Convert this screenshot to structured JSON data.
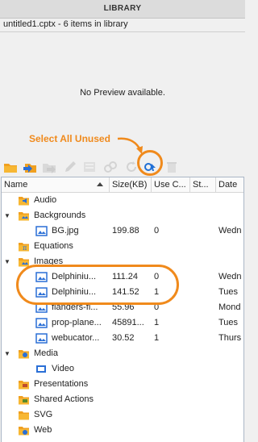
{
  "panel": {
    "title": "LIBRARY",
    "subtitle": "untitled1.cptx - 6 items in library"
  },
  "preview": {
    "text": "No Preview available."
  },
  "annotation": {
    "label": "Select All Unused",
    "color": "#f08a1c"
  },
  "toolbar": {
    "items": [
      {
        "name": "open-folder-icon",
        "enabled": true
      },
      {
        "name": "import-icon",
        "enabled": true
      },
      {
        "name": "export-icon",
        "enabled": false
      },
      {
        "name": "edit-icon",
        "enabled": false
      },
      {
        "name": "properties-icon",
        "enabled": false
      },
      {
        "name": "usage-icon",
        "enabled": false
      },
      {
        "name": "update-icon",
        "enabled": false
      },
      {
        "name": "select-all-unused-icon",
        "enabled": true
      },
      {
        "name": "delete-icon",
        "enabled": false
      }
    ]
  },
  "columns": [
    "Name",
    "Size(KB)",
    "Use C...",
    "St...",
    "Date"
  ],
  "rows": [
    {
      "type": "folder",
      "name": "Audio",
      "icon": "audio-folder-icon",
      "expandable": false
    },
    {
      "type": "folder",
      "name": "Backgrounds",
      "icon": "backgrounds-folder-icon",
      "expandable": true
    },
    {
      "type": "item",
      "name": "BG.jpg",
      "size": "199.88",
      "use": "0",
      "status": "",
      "date": "Wedn",
      "icon": "image-icon"
    },
    {
      "type": "folder",
      "name": "Equations",
      "icon": "equations-folder-icon",
      "expandable": false
    },
    {
      "type": "folder",
      "name": "Images",
      "icon": "images-folder-icon",
      "expandable": true
    },
    {
      "type": "item",
      "name": "Delphiniu...",
      "size": "111.24",
      "use": "0",
      "status": "",
      "date": "Wedn",
      "icon": "image-icon"
    },
    {
      "type": "item",
      "name": "Delphiniu...",
      "size": "141.52",
      "use": "1",
      "status": "",
      "date": "Tues",
      "icon": "image-icon"
    },
    {
      "type": "item",
      "name": "flanders-fi...",
      "size": "55.96",
      "use": "0",
      "status": "",
      "date": "Mond",
      "icon": "image-icon"
    },
    {
      "type": "item",
      "name": "prop-plane...",
      "size": "45891...",
      "use": "1",
      "status": "",
      "date": "Tues",
      "icon": "image-icon"
    },
    {
      "type": "item",
      "name": "webucator...",
      "size": "30.52",
      "use": "1",
      "status": "",
      "date": "Thurs",
      "icon": "image-icon"
    },
    {
      "type": "folder",
      "name": "Media",
      "icon": "media-folder-icon",
      "expandable": true
    },
    {
      "type": "item",
      "name": "Video",
      "size": "",
      "use": "",
      "status": "",
      "date": "",
      "icon": "video-folder-icon"
    },
    {
      "type": "folder",
      "name": "Presentations",
      "icon": "presentations-folder-icon",
      "expandable": false
    },
    {
      "type": "folder",
      "name": "Shared Actions",
      "icon": "shared-actions-folder-icon",
      "expandable": false
    },
    {
      "type": "folder",
      "name": "SVG",
      "icon": "svg-folder-icon",
      "expandable": false
    },
    {
      "type": "folder",
      "name": "Web",
      "icon": "web-folder-icon",
      "expandable": false
    }
  ]
}
